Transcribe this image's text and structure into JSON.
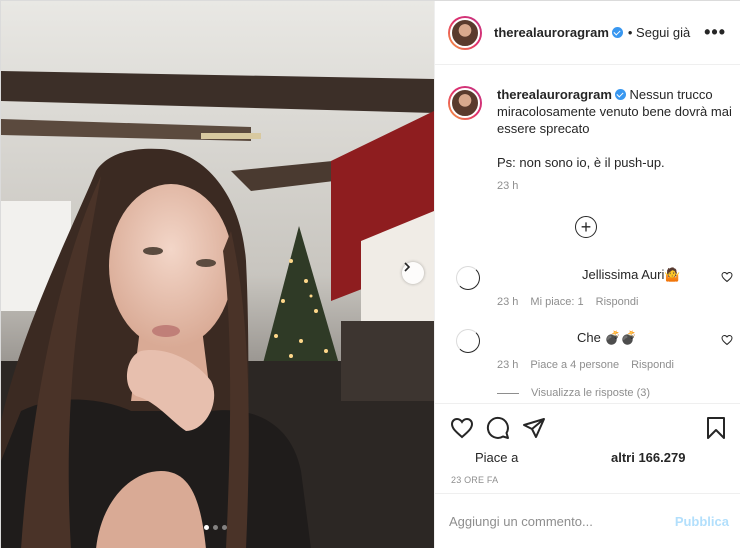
{
  "post": {
    "username": "therealauroragram",
    "follow_label": "• Segui già",
    "more_label": "•••"
  },
  "caption": {
    "username": "therealauroragram",
    "text": "Nessun trucco miracolosamente venuto bene dovrà mai essere sprecato",
    "ps": "Ps: non sono io, è il push-up.",
    "time": "23 h"
  },
  "comments": [
    {
      "text": "Jellissima Auri🤷",
      "time": "23 h",
      "likes": "Mi piace: 1",
      "reply": "Rispondi"
    },
    {
      "text": "Che 💣💣",
      "time": "23 h",
      "likes": "Piace a 4 persone",
      "reply": "Rispondi"
    }
  ],
  "view_replies": "Visualizza le risposte (3)",
  "likes": {
    "prefix": "Piace a",
    "count": "altri 166.279"
  },
  "time_ago": "23 ORE FA",
  "add_comment": {
    "placeholder": "Aggiungi un commento...",
    "publish": "Pubblica"
  },
  "carousel": {
    "slides": 3,
    "active_index": 0
  },
  "colors": {
    "link": "#b2dffc",
    "verified": "#3897f0",
    "muted": "#8e8e8e"
  }
}
